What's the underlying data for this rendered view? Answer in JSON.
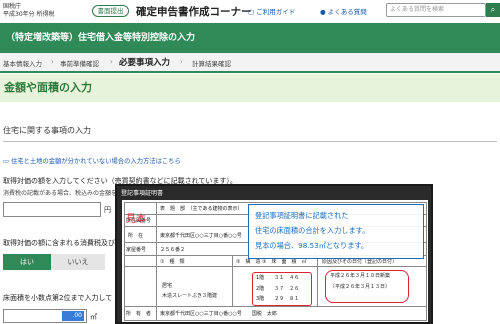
{
  "header": {
    "agency": "国税庁",
    "year_label": "平成30年分 所得税",
    "forms_button": "書面提出",
    "site_title": "確定申告書作成コーナー",
    "guide_link": "ご利用ガイド",
    "faq_link": "よくある質問",
    "search_placeholder": "よくある質問を検索"
  },
  "band_title": "（特定増改築等）住宅借入金等特別控除の入力",
  "steps": [
    "基本情報入力",
    "事前準備確認",
    "必要事項入力",
    "計算結果確認"
  ],
  "section_title": "金額や面積の入力",
  "subheading": "住宅に関する事項の入力",
  "help_link": "住宅と土地の金額が分かれていない場合の入力方法はこちら",
  "q1": {
    "label": "取得対価の額を入力してください（売買契約書などに記載されています）。",
    "note": "消費税の記載がある場合、税込みの金額を",
    "unit": "円",
    "value": ""
  },
  "q2": {
    "label": "取得対価の額に含まれる消費税及び",
    "yes": "はい",
    "no": "いいえ"
  },
  "q3": {
    "label": "床面積を小数点第2位まで入力して",
    "value": ".00",
    "unit": "㎡"
  },
  "popup": {
    "title": "登記事項証明書",
    "stamp": "見本",
    "doc": {
      "header": "表　題　部",
      "header_note": "（主である建物の表示）",
      "col_labels": [
        "所在図番号",
        "所　在",
        "家屋番号",
        "①　種　類",
        "②　構　造",
        "③　床　面　積　㎡",
        "原因及びその日付〔登記の日付〕"
      ],
      "address": "東京都千代田区○○三丁目○番○○号",
      "house_no": "２５６番２",
      "type": "居宅",
      "structure": "木造スレートぶき３階建",
      "floors": [
        "1階　　３１　４６",
        "2階　　３７　２６",
        "3階　　２９　８１"
      ],
      "dates": [
        "平成２６年３月１０日新築",
        "〔平成２６年３月１３日〕"
      ],
      "owner_label": "所　有　者",
      "owner": "東京都千代田区○○三丁目○番○○号　　国税　太郎"
    },
    "annotation": [
      "登記事項証明書に記載された",
      "住宅の床面積の合計を入力します。",
      "見本の場合、98.53㎡となります。"
    ]
  }
}
